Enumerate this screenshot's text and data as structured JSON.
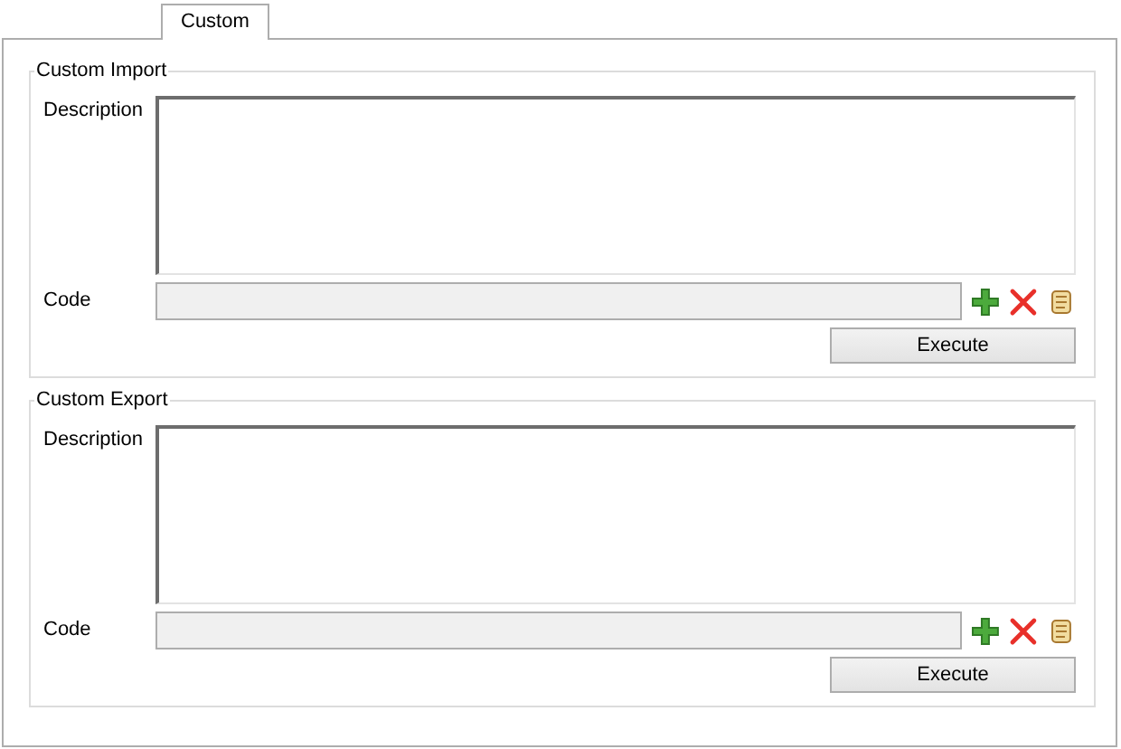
{
  "tabs": [
    {
      "label": "Custom",
      "selected": true
    }
  ],
  "groups": [
    {
      "title": "Custom Import",
      "description_label": "Description",
      "code_label": "Code",
      "code_disabled": true,
      "button": "Execute"
    },
    {
      "title": "Custom Export",
      "description_label": "Description",
      "code_label": "Code",
      "code_disabled": true,
      "button": "Execute"
    }
  ]
}
